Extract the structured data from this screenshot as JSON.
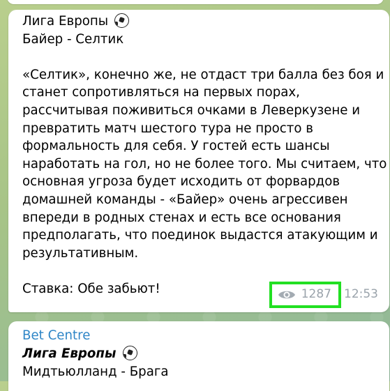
{
  "message1": {
    "title": "Лига Европы",
    "match": "Байер - Селтик",
    "body_lines": [
      "«Селтик», конечно же, не отдаст три балла без боя и",
      "станет сопротивляться на первых порах,",
      "рассчитывая поживиться очками в Леверкузене и",
      "превратить матч шестого тура не просто в",
      "формальность для себя. У гостей есть шансы",
      "наработать на гол, но не более того. Мы считаем, что",
      "основная угроза будет исходить от форвардов",
      "домашней команды - «Байер» очень агрессивен",
      "впереди в родных стенах и есть все основания",
      "предполагать, что поединок выдастся атакующим и",
      "результативным."
    ],
    "bet": "Ставка: Обе забьют!",
    "views": "1287",
    "time": "12:53",
    "highlight_color": "#22e022"
  },
  "message2": {
    "sender": "Bet Centre",
    "title": "Лига Европы",
    "match": "Мидтьюлланд - Брага"
  },
  "icons": [
    "soccer-ball-icon",
    "eye-icon"
  ]
}
